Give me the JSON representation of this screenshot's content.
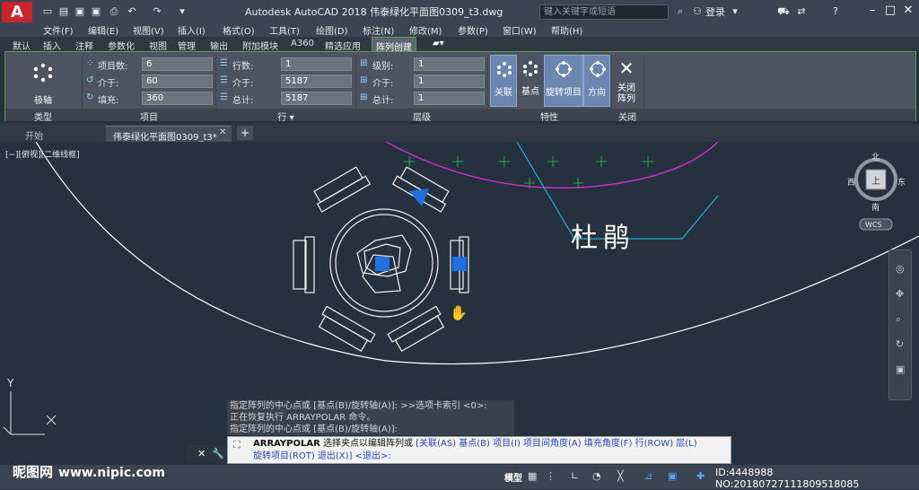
{
  "titlebar": {
    "app_icon": "A",
    "title": "Autodesk AutoCAD 2018    伟泰绿化平面图0309_t3.dwg",
    "search_placeholder": "键入关键字或短语",
    "login": "登录"
  },
  "menus": [
    "文件(F)",
    "编辑(E)",
    "视图(V)",
    "插入(I)",
    "格式(O)",
    "工具(T)",
    "绘图(D)",
    "标注(N)",
    "修改(M)",
    "参数(P)",
    "窗口(W)",
    "帮助(H)"
  ],
  "ribbon_tabs": [
    "默认",
    "插入",
    "注释",
    "参数化",
    "视图",
    "管理",
    "输出",
    "附加模块",
    "A360",
    "精选应用",
    "阵列创建"
  ],
  "ribbon": {
    "polar_label": "极轴",
    "type_panel": "类型",
    "items_panel": "项目",
    "rows_panel": "行 ▾",
    "levels_panel": "层级",
    "props_panel": "特性",
    "close_panel": "关闭",
    "items_count_label": "项目数:",
    "items_count": "6",
    "items_between_label": "介于:",
    "items_between": "60",
    "items_fill_label": "填充:",
    "items_fill": "360",
    "rows_label": "行数:",
    "rows": "1",
    "rows_between_label": "介于:",
    "rows_between": "5187",
    "rows_total_label": "总计:",
    "rows_total": "5187",
    "levels_label": "级别:",
    "levels": "1",
    "levels_between_label": "介于:",
    "levels_between": "1",
    "levels_total_label": "总计:",
    "levels_total": "1",
    "btn_assoc": "关联",
    "btn_base": "基点",
    "btn_rotate": "旋转项目",
    "btn_dir": "方向",
    "btn_close": "关闭\n阵列"
  },
  "doc_tabs": [
    "开始",
    "伟泰绿化平面图0309_t3*"
  ],
  "viewport": {
    "view_label": "[−][俯视][二维线框]",
    "drawing_text": "杜鹃",
    "compass_n": "北",
    "compass_s": "南",
    "compass_e": "东",
    "compass_w": "西",
    "compass_top": "上",
    "wcs": "WCS",
    "ucs_y": "Y"
  },
  "command": {
    "history": [
      "指定阵列的中心点或 [基点(B)/旋转轴(A)]: >>选项卡索引 <0>:",
      "正在恢复执行 ARRAYPOLAR 命令。",
      "指定阵列的中心点或 [基点(B)/旋转轴(A)]:"
    ],
    "prompt_cmd": "ARRAYPOLAR",
    "prompt_text": "选择夹点以编辑阵列或",
    "options_line1": "[关联(AS) 基点(B) 项目(I) 项目间角度(A) 填充角度(F) 行(ROW) 层(L)",
    "options_line2": "旋转项目(ROT) 退出(X)] <退出>:"
  },
  "statusbar": {
    "model": "模型",
    "id_text": "ID:4448988 NO:20180727111809518085"
  },
  "watermark": {
    "brand": "昵图网",
    "url": "www.nipic.com"
  },
  "colors": {
    "accent_green": "#5e9b48",
    "canvas_bg": "#263140",
    "magenta_curve": "#c832c8",
    "cyan_line": "#20b3c8",
    "selection_blue": "#1f6fe0"
  }
}
